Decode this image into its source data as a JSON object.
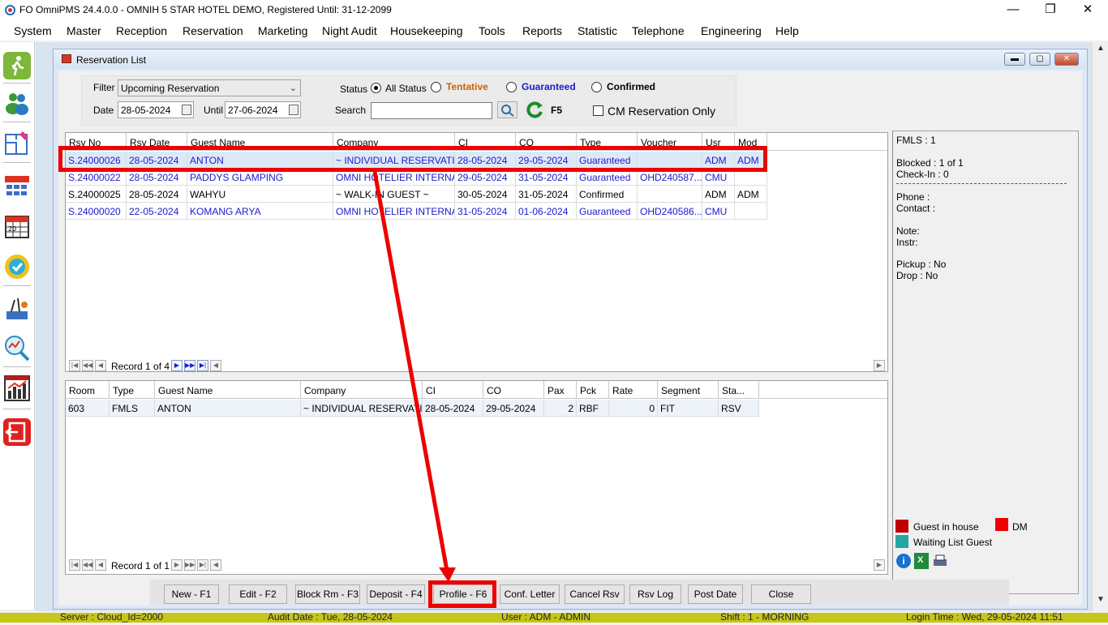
{
  "window": {
    "title": "FO OmniPMS 24.4.0.0 - OMNIH 5 STAR HOTEL DEMO, Registered Until: 31-12-2099",
    "min_label": "—",
    "restore_label": "❐",
    "close_label": "✕"
  },
  "menu": [
    "System",
    "Master",
    "Reception",
    "Reservation",
    "Marketing",
    "Night Audit",
    "Housekeeping",
    "Tools",
    "Reports",
    "Statistic",
    "Telephone",
    "Engineering",
    "Help"
  ],
  "child": {
    "title": "Reservation List"
  },
  "filter": {
    "filter_label": "Filter",
    "filter_value": "Upcoming Reservation",
    "date_label": "Date",
    "date_value": "28-05-2024",
    "until_label": "Until",
    "until_value": "27-06-2024",
    "status_label": "Status",
    "status_options": [
      "All Status",
      "Tentative",
      "Guaranteed",
      "Confirmed"
    ],
    "status_selected": "All Status",
    "search_label": "Search",
    "search_value": "",
    "refresh_key": "F5",
    "cm_only_label": "CM Reservation Only",
    "cm_only_checked": false
  },
  "rsv_grid": {
    "columns": [
      "Rsv No",
      "Rsv Date",
      "Guest Name",
      "Company",
      "CI",
      "CO",
      "Type",
      "Voucher",
      "Usr",
      "Mod"
    ],
    "rows": [
      [
        "S.24000026",
        "28-05-2024",
        "ANTON",
        "~ INDIVIDUAL RESERVATI...",
        "28-05-2024",
        "29-05-2024",
        "Guaranteed",
        "",
        "ADM",
        "ADM"
      ],
      [
        "S.24000022",
        "28-05-2024",
        "PADDYS GLAMPING",
        "OMNI HOTELIER INTERNAS...",
        "29-05-2024",
        "31-05-2024",
        "Guaranteed",
        "OHD240587...",
        "CMU",
        ""
      ],
      [
        "S.24000025",
        "28-05-2024",
        "WAHYU",
        "~ WALK-IN GUEST ~",
        "30-05-2024",
        "31-05-2024",
        "Confirmed",
        "",
        "ADM",
        "ADM"
      ],
      [
        "S.24000020",
        "22-05-2024",
        "KOMANG ARYA",
        "OMNI HOTELIER INTERNAS...",
        "31-05-2024",
        "01-06-2024",
        "Guaranteed",
        "OHD240586...",
        "CMU",
        ""
      ]
    ],
    "record_text": "Record 1 of 4"
  },
  "room_grid": {
    "columns": [
      "Room",
      "Type",
      "Guest Name",
      "Company",
      "CI",
      "CO",
      "Pax",
      "Pck",
      "Rate",
      "Segment",
      "Sta..."
    ],
    "rows": [
      [
        "603",
        "FMLS",
        "ANTON",
        "~ INDIVIDUAL RESERVATI...",
        "28-05-2024",
        "29-05-2024",
        "2",
        "RBF",
        "0",
        "FIT",
        "RSV"
      ]
    ],
    "record_text": "Record 1 of 1"
  },
  "info": {
    "fmls": "FMLS : 1",
    "blocked": "Blocked : 1 of 1",
    "checkin": "Check-In : 0",
    "phone": "Phone :",
    "contact": "Contact :",
    "note": "Note:",
    "instr": "Instr:",
    "pickup": "Pickup : No",
    "drop": "Drop : No"
  },
  "legend": {
    "guest_in_house": "Guest in house",
    "dm": "DM",
    "waiting_list": "Waiting List Guest",
    "colors": {
      "guest_in_house": "#c00000",
      "dm": "#ee0000",
      "waiting_list": "#20a8a0"
    }
  },
  "buttons": [
    "New - F1",
    "Edit - F2",
    "Block Rm - F3",
    "Deposit - F4",
    "Profile  - F6",
    "Conf. Letter",
    "Cancel Rsv",
    "Rsv Log",
    "Post Date",
    "Close"
  ],
  "statusbar": {
    "server": "Server : Cloud_Id=2000",
    "audit": "Audit Date : Tue, 28-05-2024",
    "user": "User : ADM - ADMIN",
    "shift": "Shift : 1 - MORNING",
    "login": "Login Time : Wed, 29-05-2024 11:51"
  },
  "colors": {
    "guaranteed": "#1a1ad0",
    "tentative": "#d06000",
    "annotation": "#ee0000",
    "statusbar": "#c6c619"
  },
  "icons": [
    "walk-icon",
    "guests-icon",
    "floorplan-icon",
    "room-grid-icon",
    "calendar-icon",
    "badge-icon",
    "housekeeping-icon",
    "analysis-icon",
    "chart-icon",
    "exit-icon"
  ]
}
